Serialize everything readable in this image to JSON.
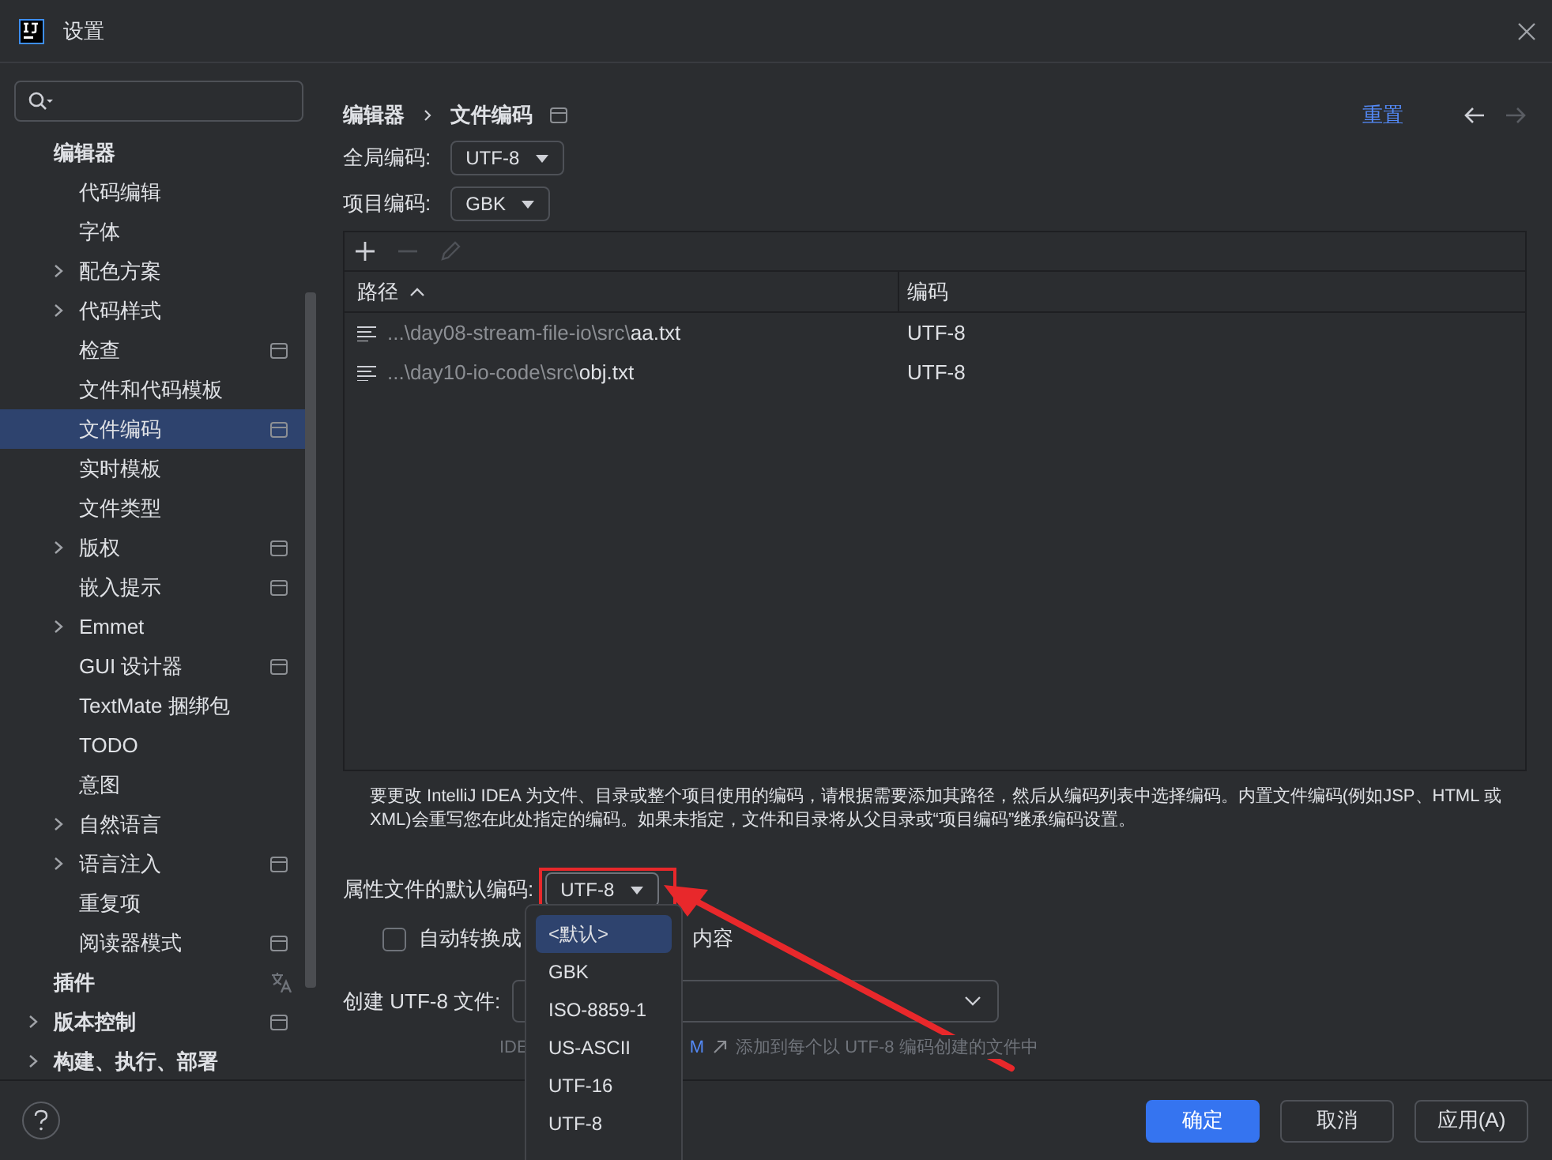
{
  "window": {
    "title": "设置"
  },
  "sidebar": {
    "items": [
      {
        "label": "编辑器",
        "selected": false,
        "children": [
          {
            "label": "代码编辑",
            "selected": false
          },
          {
            "label": "字体",
            "selected": false
          },
          {
            "label": "配色方案",
            "selected": false,
            "expanded": false
          },
          {
            "label": "代码样式",
            "selected": false,
            "expanded": false
          },
          {
            "label": "检查",
            "selected": false,
            "project_scoped": true
          },
          {
            "label": "文件和代码模板",
            "selected": false
          },
          {
            "label": "文件编码",
            "selected": true,
            "project_scoped": true
          },
          {
            "label": "实时模板",
            "selected": false
          },
          {
            "label": "文件类型",
            "selected": false
          },
          {
            "label": "版权",
            "selected": false,
            "expanded": false,
            "project_scoped": true
          },
          {
            "label": "嵌入提示",
            "selected": false,
            "project_scoped": true
          },
          {
            "label": "Emmet",
            "selected": false,
            "expanded": false
          },
          {
            "label": "GUI 设计器",
            "selected": false,
            "project_scoped": true
          },
          {
            "label": "TextMate 捆绑包",
            "selected": false
          },
          {
            "label": "TODO",
            "selected": false
          },
          {
            "label": "意图",
            "selected": false
          },
          {
            "label": "自然语言",
            "selected": false,
            "expanded": false
          },
          {
            "label": "语言注入",
            "selected": false,
            "expanded": false,
            "project_scoped": true
          },
          {
            "label": "重复项",
            "selected": false
          },
          {
            "label": "阅读器模式",
            "selected": false,
            "project_scoped": true
          }
        ]
      },
      {
        "label": "插件",
        "selected": false,
        "localized": true
      },
      {
        "label": "版本控制",
        "selected": false,
        "expanded": false,
        "project_scoped": true
      },
      {
        "label": "构建、执行、部署",
        "selected": false,
        "expanded": false
      }
    ]
  },
  "breadcrumb": [
    "编辑器",
    "文件编码"
  ],
  "reset_link": "重置",
  "global_encoding": {
    "label": "全局编码:",
    "value": "UTF-8"
  },
  "project_encoding": {
    "label": "项目编码:",
    "value": "GBK"
  },
  "toolbar": [
    {
      "kind": "add",
      "disabled": false
    },
    {
      "kind": "remove",
      "disabled": true
    },
    {
      "kind": "edit",
      "disabled": true
    }
  ],
  "table": {
    "columns": [
      {
        "label": "路径",
        "sorted": true
      },
      {
        "label": "编码",
        "sorted": false
      }
    ],
    "rows": [
      {
        "path": "...\\day08-stream-file-io\\src\\",
        "file": "aa.txt",
        "encoding": "UTF-8"
      },
      {
        "path": "...\\day10-io-code\\src\\",
        "file": "obj.txt",
        "encoding": "UTF-8"
      }
    ]
  },
  "description": "要更改 IntelliJ IDEA 为文件、目录或整个项目使用的编码，请根据需要添加其路径，然后从编码列表中选择编码。内置文件编码(例如JSP、HTML 或 XML)会重写您在此处指定的编码。如果未指定，文件和目录将从父目录或“项目编码”继承编码设置。",
  "properties_encoding": {
    "label": "属性文件的默认编码:",
    "value": "UTF-8",
    "expanded": true,
    "options": [
      {
        "label": "<默认>",
        "highlighted": true
      },
      {
        "label": "GBK",
        "highlighted": false
      },
      {
        "label": "ISO-8859-1",
        "highlighted": false
      },
      {
        "label": "US-ASCII",
        "highlighted": false
      },
      {
        "label": "UTF-16",
        "highlighted": false
      },
      {
        "label": "UTF-8",
        "highlighted": false
      }
    ]
  },
  "auto_convert": {
    "label_start": "自动转换成",
    "label_end": "内容",
    "checked": false
  },
  "create_utf8": {
    "label": "创建 UTF-8 文件:"
  },
  "note": {
    "start": "IDE",
    "link": "M",
    "end": "添加到每个以 UTF-8 编码创建的文件中"
  },
  "buttons": [
    {
      "label": "确定",
      "kind": "primary"
    },
    {
      "label": "取消",
      "kind": "normal"
    },
    {
      "label": "应用(A)",
      "kind": "normal"
    }
  ]
}
